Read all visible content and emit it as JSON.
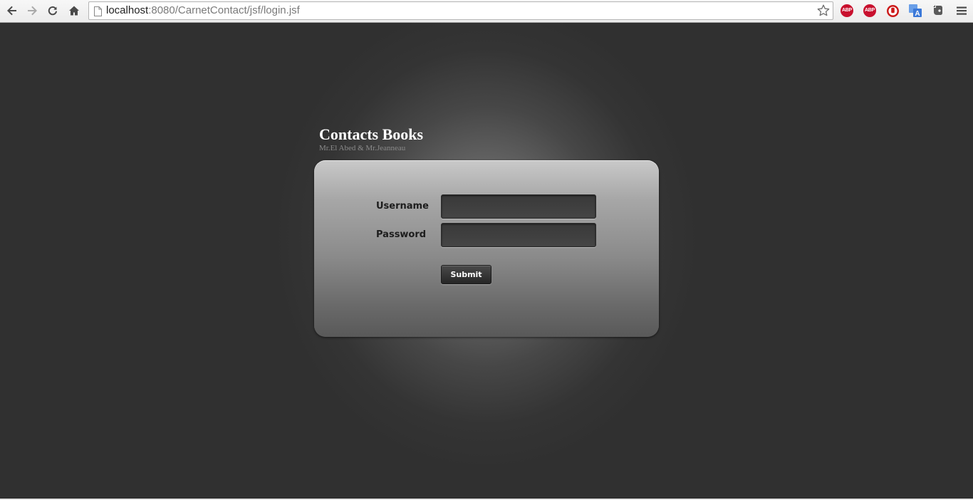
{
  "browser": {
    "url_host": "localhost",
    "url_rest": ":8080/CarnetContact/jsf/login.jsf",
    "extensions": [
      {
        "name": "adblock-plus-icon",
        "label": "ABP"
      },
      {
        "name": "adblock-plus-icon-2",
        "label": "ABP"
      },
      {
        "name": "stop-hand-icon",
        "label": ""
      },
      {
        "name": "translate-icon",
        "label": "A"
      },
      {
        "name": "evernote-icon",
        "label": ""
      }
    ]
  },
  "page": {
    "title": "Contacts Books",
    "subtitle": "Mr.El Abed & Mr.Jeanneau"
  },
  "form": {
    "username_label": "Username",
    "password_label": "Password",
    "username_value": "",
    "password_value": "",
    "submit_label": "Submit"
  },
  "colors": {
    "background": "#303030",
    "card_top": "#c9c9c9",
    "card_bottom": "#595959",
    "input_bg": "#3d3d3d",
    "button_bg": "#2f2f2f",
    "abp_red": "#c8102e"
  }
}
